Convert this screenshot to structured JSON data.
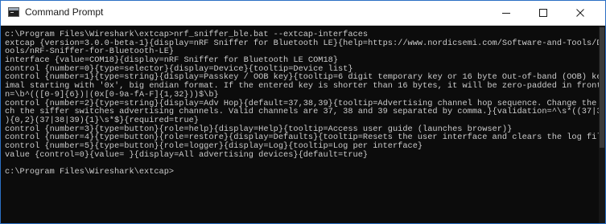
{
  "window": {
    "title": "Command Prompt",
    "accent_color": "#2b6fc4",
    "console_text_color": "#cccccc",
    "console_background": "#0c0c0c",
    "icon": "console-icon",
    "controls": {
      "minimize_icon": "minimize-icon",
      "maximize_icon": "maximize-icon",
      "close_icon": "close-icon"
    }
  },
  "console": {
    "lines": [
      "c:\\Program Files\\Wireshark\\extcap>nrf_sniffer_ble.bat --extcap-interfaces",
      "extcap {version=3.0.0-beta-1}{display=nRF Sniffer for Bluetooth LE}{help=https://www.nordicsemi.com/Software-and-Tools/Development-T",
      "ools/nRF-Sniffer-for-Bluetooth-LE}",
      "interface {value=COM18}{display=nRF Sniffer for Bluetooth LE COM18}",
      "control {number=0}{type=selector}{display=Device}{tooltip=Device list}",
      "control {number=1}{type=string}{display=Passkey / OOB key}{tooltip=6 digit temporary key or 16 byte Out-of-band (OOB) key in hexadec",
      "imal starting with '0x', big endian format. If the entered key is shorter than 16 bytes, it will be zero-padded in front'}{validatio",
      "n=\\b^(([0-9]{6})|(0x[0-9a-fA-F]{1,32}))$\\b}",
      "control {number=2}{type=string}{display=Adv Hop}{default=37,38,39}{tooltip=Advertising channel hop sequence. Change the order in whi",
      "ch the siffer switches advertising channels. Valid channels are 37, 38 and 39 separated by comma.}{validation=^\\s*((37|38|39)\\s*,\\s*",
      "){0,2}(37|38|39){1}\\s*$}{required=true}",
      "control {number=3}{type=button}{role=help}{display=Help}{tooltip=Access user guide (launches browser)}",
      "control {number=4}{type=button}{role=restore}{display=Defaults}{tooltip=Resets the user interface and clears the log file}",
      "control {number=5}{type=button}{role=logger}{display=Log}{tooltip=Log per interface}",
      "value {control=0}{value= }{display=All advertising devices}{default=true}",
      "",
      "c:\\Program Files\\Wireshark\\extcap>"
    ]
  }
}
